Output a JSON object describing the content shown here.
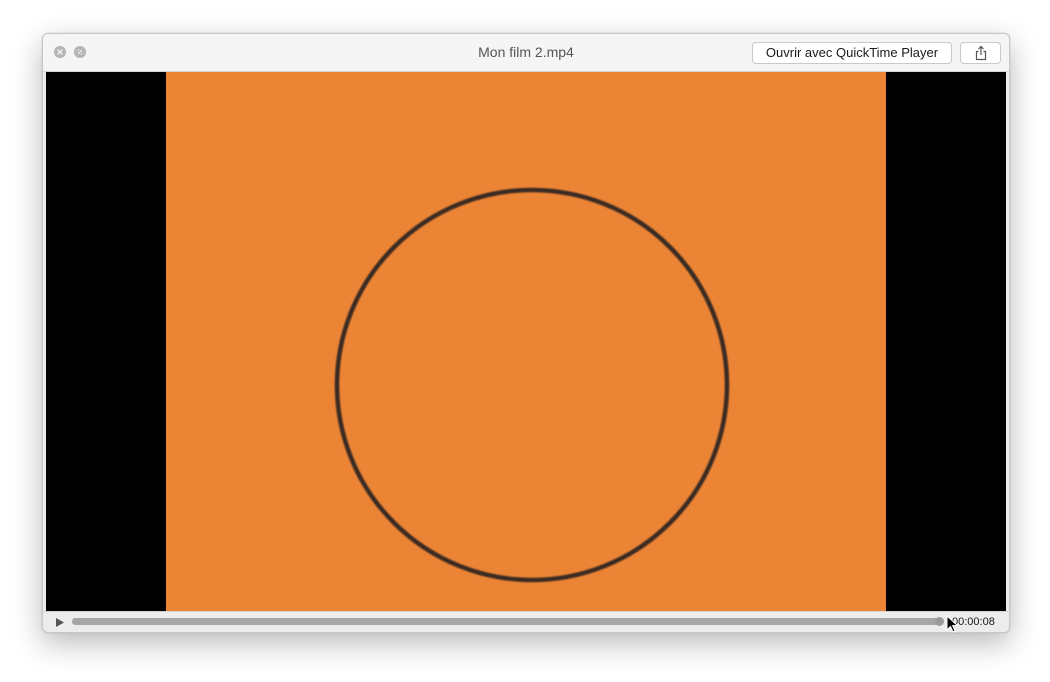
{
  "window": {
    "title": "Mon film 2.mp4",
    "open_with_button_label": "Ouvrir avec QuickTime Player",
    "share_icon": "share-icon",
    "close_icon": "close-icon",
    "fullscreen_icon": "fullscreen-icon"
  },
  "video": {
    "frame_color": "#ec8435",
    "letterbox_color": "#000000",
    "circle_stroke_color": "#3a2c20"
  },
  "controls": {
    "play_icon": "play-icon",
    "playback_progress": 1.0,
    "time_display": "00:00:08"
  }
}
